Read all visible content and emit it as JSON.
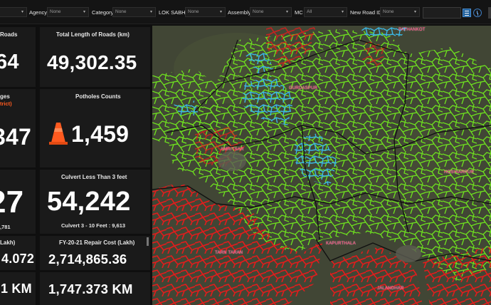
{
  "filters": [
    {
      "label": "Agency",
      "value": "None"
    },
    {
      "label": "Category",
      "value": "None"
    },
    {
      "label": "LOK SABHA",
      "value": "None"
    },
    {
      "label": "Assembly",
      "value": "None"
    },
    {
      "label": "MC",
      "value": "All"
    },
    {
      "label": "New Road ID",
      "value": "None"
    }
  ],
  "kpis": {
    "roads_partial": {
      "title": "Roads",
      "value": "64"
    },
    "total_length": {
      "title": "Total Length of  Roads (km)",
      "value": "49,302.35"
    },
    "bridges_partial": {
      "title": "ges",
      "subtitle": "trict)",
      "value": "347"
    },
    "potholes": {
      "title": "Potholes Counts",
      "value": "1,459",
      "icon": "traffic-cone-icon"
    },
    "partial_left": {
      "value": "27",
      "sub": ",781"
    },
    "culvert": {
      "title": "Culvert Less Than 3 feet",
      "value": "54,242",
      "sub": "Culvert 3 - 10 Feet : 9,613"
    },
    "cost_partial": {
      "title": "Lakh)",
      "value": "4.072"
    },
    "repair_cost": {
      "title": "FY-20-21 Repair Cost (Lakh)",
      "value": "2,714,865.36"
    },
    "km_partial": {
      "value": "1 KM"
    },
    "km_total": {
      "value": "1,747.373 KM"
    }
  },
  "map": {
    "place_labels": [
      "PATHANKOT",
      "GURDASPUR",
      "AMRITSAR",
      "HOSHIARPUR",
      "TARN TARAN",
      "KAPURTHALA",
      "JALANDHAR"
    ],
    "colors": {
      "good": "#6ee21e",
      "moderate": "#35b5e0",
      "poor": "#d61f1f",
      "label": "#ff2e6e"
    }
  },
  "colors": {
    "accent_orange": "#ff5a1f",
    "tool_blue": "#1f5f9a"
  }
}
